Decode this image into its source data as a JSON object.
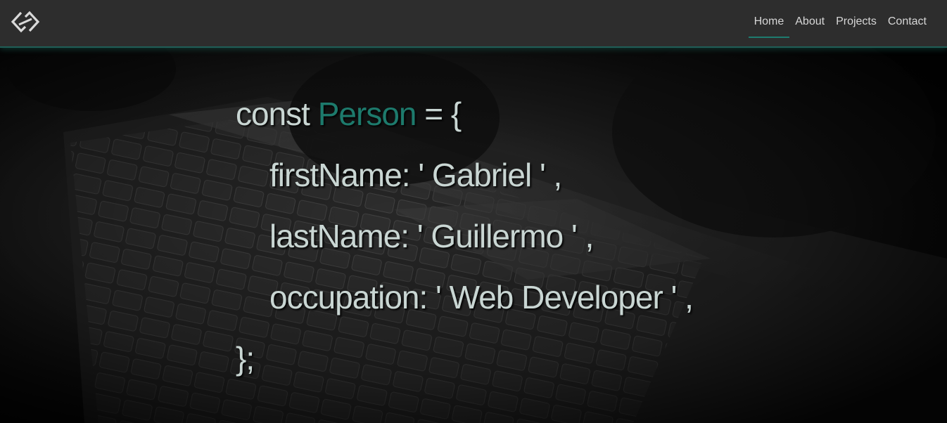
{
  "nav": {
    "logo_icon": "diamond-link-logo-icon",
    "items": [
      {
        "label": "Home",
        "active": true
      },
      {
        "label": "About",
        "active": false
      },
      {
        "label": "Projects",
        "active": false
      },
      {
        "label": "Contact",
        "active": false
      }
    ]
  },
  "hero": {
    "background": "laptop-keyboard-photo",
    "line1": {
      "keyword": "const",
      "name": "Person",
      "rest": "= {"
    },
    "line2": "firstName: ' Gabriel ' ,",
    "line3": "lastName: ' Guillermo ' ,",
    "line4": "occupation: ' Web Developer ' ,",
    "line5": "};"
  },
  "colors": {
    "accent": "#1d7a6c",
    "navbar": "#2d2d2d",
    "text": "#c9d6d3"
  }
}
